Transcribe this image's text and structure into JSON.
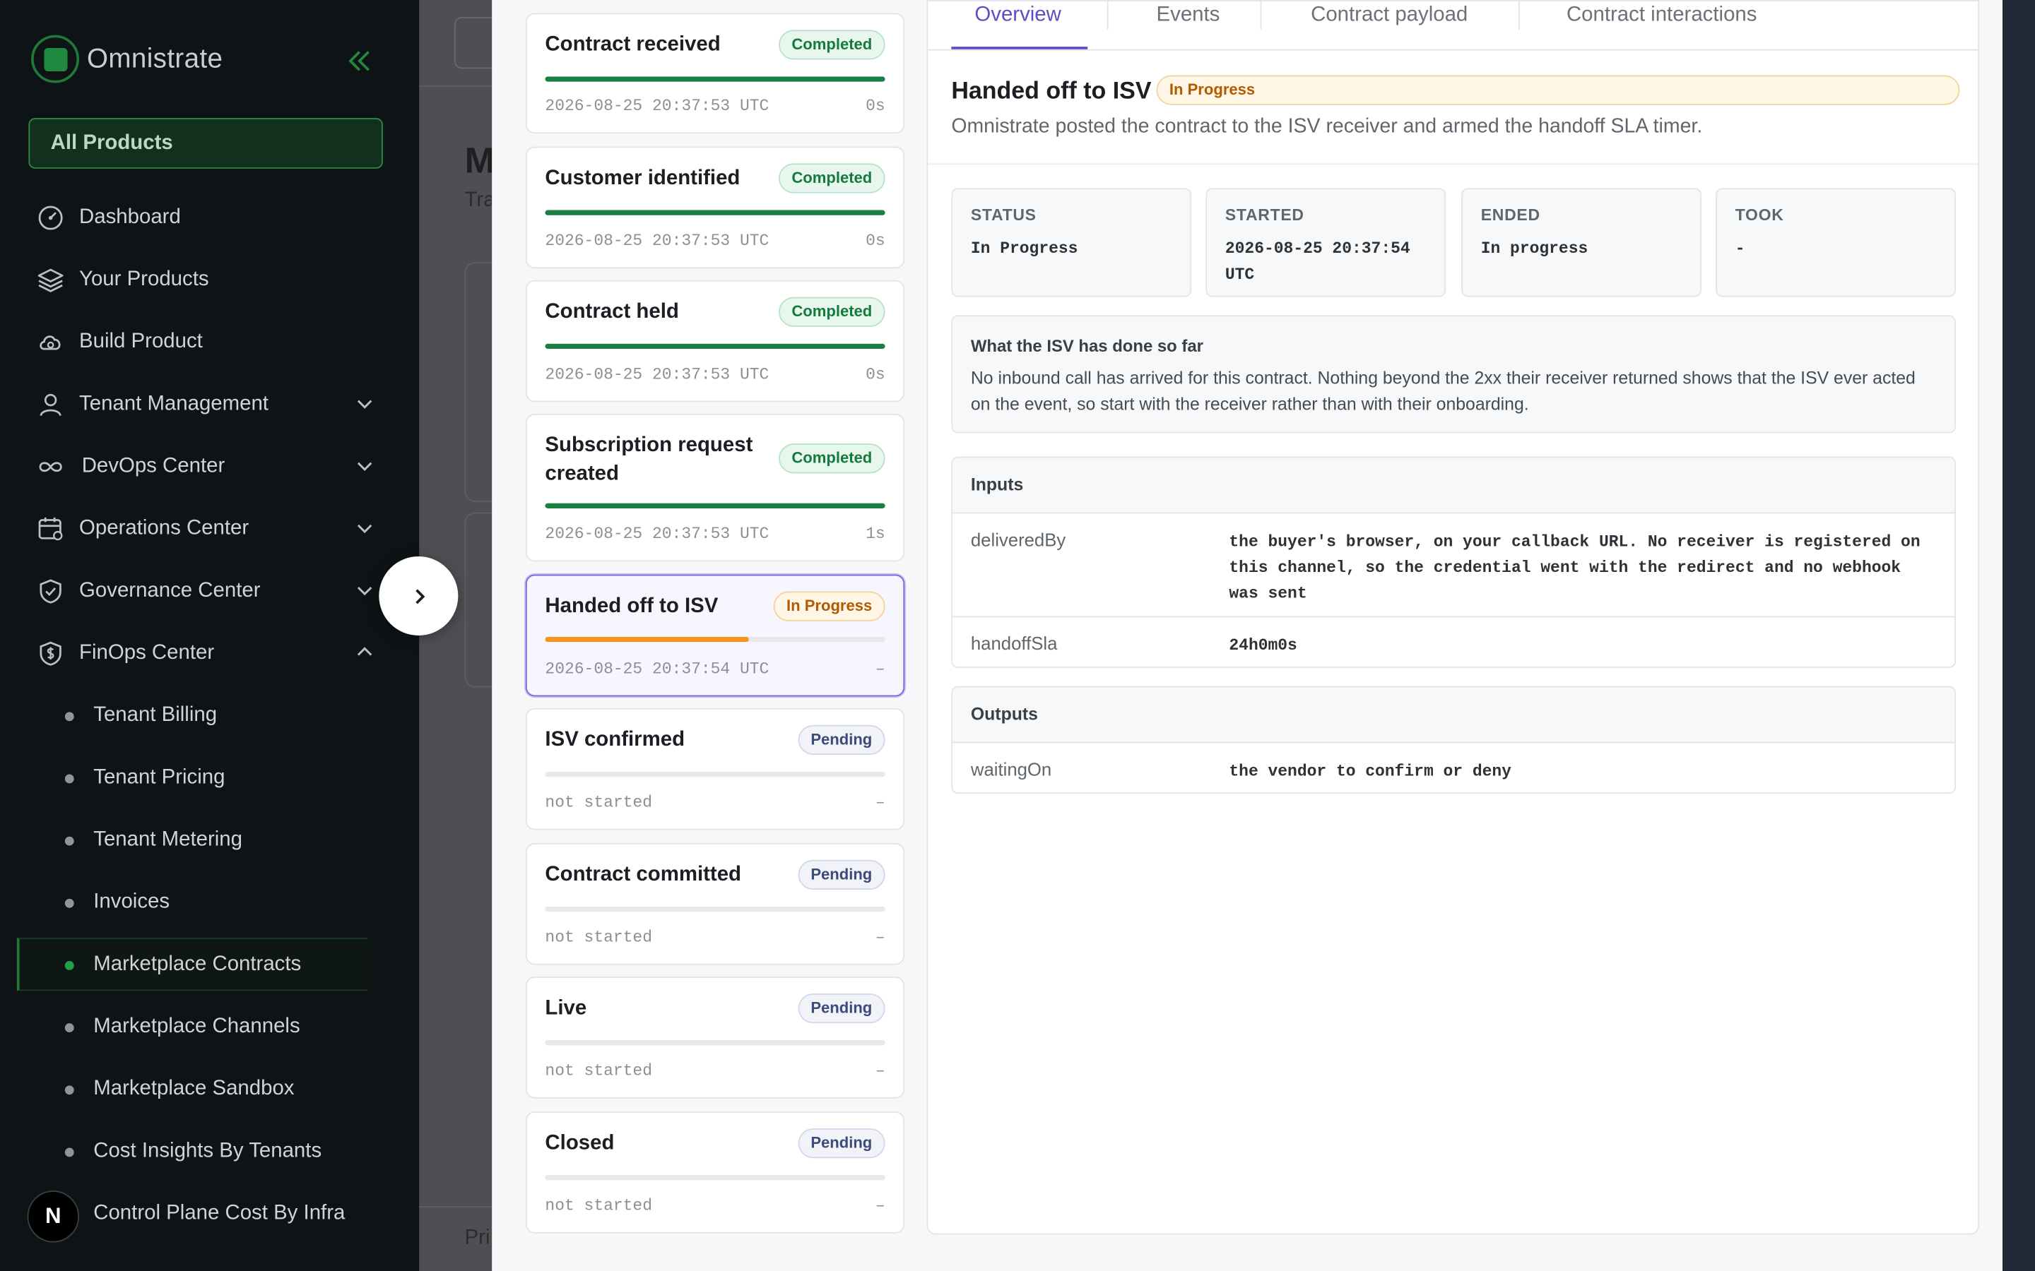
{
  "sidebar": {
    "brand": "Omnistrate",
    "all_products": "All Products",
    "items": [
      {
        "label": "Dashboard"
      },
      {
        "label": "Your Products"
      },
      {
        "label": "Build Product"
      },
      {
        "label": "Tenant Management"
      },
      {
        "label": "DevOps Center"
      },
      {
        "label": "Operations Center"
      },
      {
        "label": "Governance Center"
      },
      {
        "label": "FinOps Center"
      }
    ],
    "sub_items": [
      {
        "label": "Tenant Billing"
      },
      {
        "label": "Tenant Pricing"
      },
      {
        "label": "Tenant Metering"
      },
      {
        "label": "Invoices"
      },
      {
        "label": "Marketplace Contracts"
      },
      {
        "label": "Marketplace Channels"
      },
      {
        "label": "Marketplace Sandbox"
      },
      {
        "label": "Cost Insights By Tenants"
      },
      {
        "label": "Control Plane Cost By Infra"
      }
    ],
    "active_sub_item": "Marketplace Contracts",
    "avatar_initial": "N"
  },
  "background": {
    "title_fragment": "M",
    "subtitle_fragment": "Tra",
    "footer_fragment": "Pri"
  },
  "steps": [
    {
      "title": "Contract received",
      "status": "Completed",
      "time": "2026-08-25 20:37:53 UTC",
      "duration": "0s",
      "progress": 1.0
    },
    {
      "title": "Customer identified",
      "status": "Completed",
      "time": "2026-08-25 20:37:53 UTC",
      "duration": "0s",
      "progress": 1.0
    },
    {
      "title": "Contract held",
      "status": "Completed",
      "time": "2026-08-25 20:37:53 UTC",
      "duration": "0s",
      "progress": 1.0
    },
    {
      "title": "Subscription request created",
      "status": "Completed",
      "time": "2026-08-25 20:37:53 UTC",
      "duration": "1s",
      "progress": 1.0
    },
    {
      "title": "Handed off to ISV",
      "status": "In Progress",
      "time": "2026-08-25 20:37:54 UTC",
      "duration": "–",
      "progress": 0.6
    },
    {
      "title": "ISV confirmed",
      "status": "Pending",
      "time": "not started",
      "duration": "–",
      "progress": 0
    },
    {
      "title": "Contract committed",
      "status": "Pending",
      "time": "not started",
      "duration": "–",
      "progress": 0
    },
    {
      "title": "Live",
      "status": "Pending",
      "time": "not started",
      "duration": "–",
      "progress": 0
    },
    {
      "title": "Closed",
      "status": "Pending",
      "time": "not started",
      "duration": "–",
      "progress": 0
    }
  ],
  "tabs": [
    {
      "label": "Overview",
      "active": true
    },
    {
      "label": "Events",
      "active": false
    },
    {
      "label": "Contract payload",
      "active": false
    },
    {
      "label": "Contract interactions",
      "active": false
    }
  ],
  "detail": {
    "title": "Handed off to ISV",
    "status": "In Progress",
    "description": "Omnistrate posted the contract to the ISV receiver and armed the handoff SLA timer.",
    "stats": [
      {
        "label": "STATUS",
        "value": "In Progress"
      },
      {
        "label": "STARTED",
        "value": "2026-08-25 20:37:54 UTC"
      },
      {
        "label": "ENDED",
        "value": "In progress"
      },
      {
        "label": "TOOK",
        "value": "-"
      }
    ],
    "note_title": "What the ISV has done so far",
    "note_body": "No inbound call has arrived for this contract. Nothing beyond the 2xx their receiver returned shows that the ISV ever acted on the event, so start with the receiver rather than with their onboarding.",
    "inputs_title": "Inputs",
    "inputs": [
      {
        "key": "deliveredBy",
        "value": "the buyer's browser, on your callback URL. No receiver is registered on this channel, so the credential went with the redirect and no webhook was sent"
      },
      {
        "key": "handoffSla",
        "value": "24h0m0s"
      }
    ],
    "outputs_title": "Outputs",
    "outputs": [
      {
        "key": "waitingOn",
        "value": "the vendor to confirm or deny"
      }
    ]
  },
  "colors": {
    "completed": "#1a7f43",
    "in_progress": "#f59321",
    "accent": "#5b4fc4",
    "brand_green": "#1f8a3f"
  }
}
